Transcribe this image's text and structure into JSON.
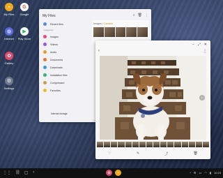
{
  "desktop": {
    "icons": [
      {
        "label": "My Files",
        "icon": "folder-icon",
        "color": "#f2a91f"
      },
      {
        "label": "Google",
        "icon": "google-icon",
        "color": "#ffffff"
      },
      {
        "label": "Internet",
        "icon": "internet-icon",
        "color": "#5a6cd8"
      },
      {
        "label": "Play Store",
        "icon": "play-store-icon",
        "color": "#ffffff"
      },
      {
        "label": "Gallery",
        "icon": "gallery-icon",
        "color": "#e04b6d"
      },
      {
        "label": "Settings",
        "icon": "gear-icon",
        "color": "#6f7a8c"
      }
    ]
  },
  "myfiles": {
    "title": "My Files",
    "recent": "Recent files",
    "categories_label": "Categories",
    "categories": [
      {
        "label": "Images",
        "color": "#e04b6d"
      },
      {
        "label": "Videos",
        "color": "#8a5be0"
      },
      {
        "label": "Audio",
        "color": "#e0a030"
      },
      {
        "label": "Documents",
        "color": "#e07a3a"
      },
      {
        "label": "Downloads",
        "color": "#3a9ae0"
      },
      {
        "label": "Installation files",
        "color": "#3ab07a"
      },
      {
        "label": "Compressed",
        "color": "#c0a050"
      },
      {
        "label": "Favorites",
        "color": "#e0c030"
      }
    ],
    "storage_label": "Internal storage",
    "storage_detail": "",
    "breadcrumb_parent": "Images",
    "breadcrumb_current": "Camera"
  },
  "viewer": {
    "tools": [
      "heart-icon",
      "edit-icon",
      "share-icon",
      "delete-icon"
    ]
  },
  "taskbar": {
    "time": "10:23"
  }
}
